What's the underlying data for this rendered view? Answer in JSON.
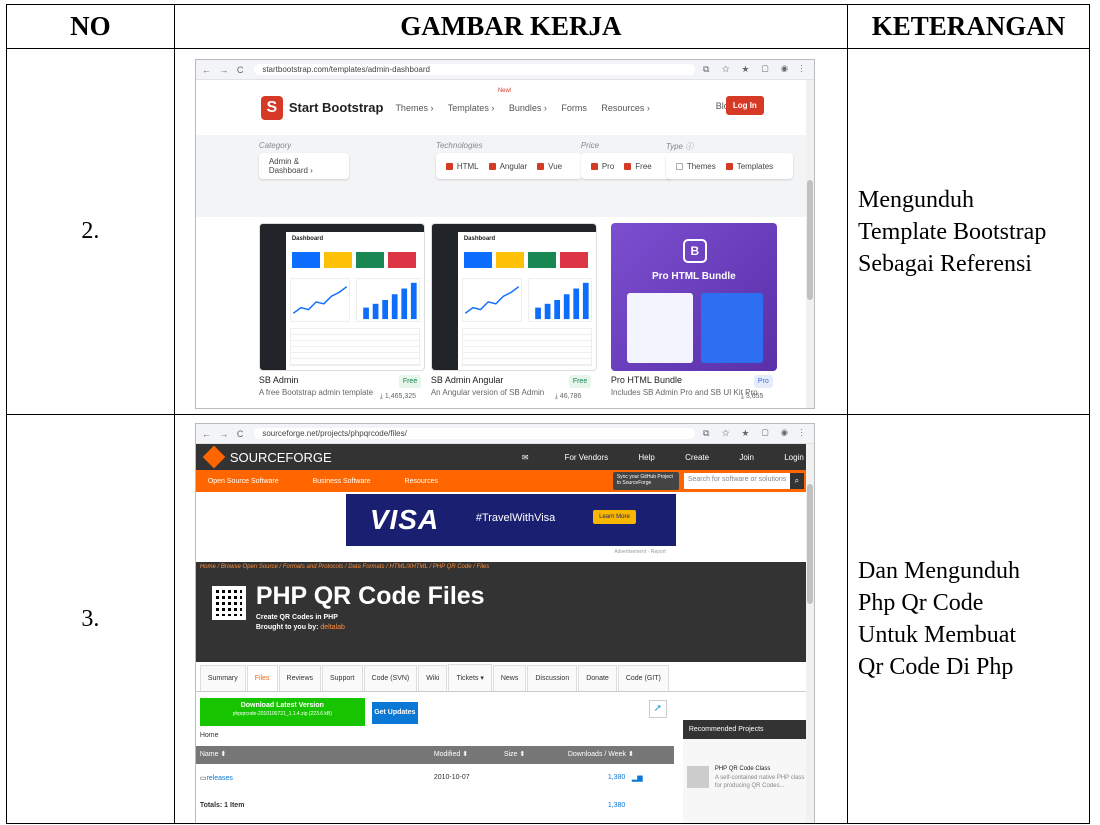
{
  "table": {
    "headers": {
      "no": "NO",
      "gambar": "GAMBAR KERJA",
      "keterangan": "KETERANGAN"
    },
    "rows": [
      {
        "no": "2.",
        "keterangan_lines": [
          "Mengunduh",
          "Template Bootstrap",
          "Sebagai Referensi"
        ]
      },
      {
        "no": "3.",
        "keterangan_lines": [
          "Dan Mengunduh",
          "Php Qr Code",
          "Untuk Membuat",
          "Qr Code Di Php"
        ]
      }
    ]
  },
  "shot1": {
    "url": "startbootstrap.com/templates/admin-dashboard",
    "brand": "Start Bootstrap",
    "logo_letter": "S",
    "nav": [
      "Themes ›",
      "Templates ›",
      "Bundles ›",
      "Forms",
      "Resources ›"
    ],
    "new_badge": "New!",
    "blog": "Blog",
    "login": "Log In",
    "filters": {
      "category_caption": "Category",
      "category_value": "Admin & Dashboard ›",
      "technologies_caption": "Technologies",
      "technologies": [
        "HTML",
        "Angular",
        "Vue"
      ],
      "price_caption": "Price",
      "price": [
        "Pro",
        "Free"
      ],
      "type_caption": "Type ⓘ",
      "type": [
        "Themes",
        "Templates"
      ]
    },
    "card_dash_title": "Dashboard",
    "pro_logo": "B",
    "pro_title": "Pro HTML Bundle",
    "cards": [
      {
        "title": "SB Admin",
        "desc": "A free Bootstrap admin template",
        "badge": "Free",
        "downloads": "⤓ 1,465,325"
      },
      {
        "title": "SB Admin Angular",
        "desc": "An Angular version of SB Admin",
        "badge": "Free",
        "downloads": "⤓ 46,786"
      },
      {
        "title": "Pro HTML Bundle",
        "desc": "Includes SB Admin Pro and SB UI Kit Pro",
        "badge": "Pro",
        "downloads": "⤓ 3,655"
      }
    ],
    "colors": {
      "accent": "#d63a26",
      "free": "#e6f6ea",
      "pro": "#e6ecfb"
    }
  },
  "shot2": {
    "url": "sourceforge.net/projects/phpqrcode/files/",
    "logo_text": "SOURCEFORGE",
    "top_links": [
      "For Vendors",
      "Help",
      "Create",
      "Join",
      "Login"
    ],
    "orange_links": [
      "Open Source Software",
      "Business Software",
      "Resources"
    ],
    "github_sync": "Sync your GitHub Project to SourceForge",
    "search_placeholder": "Search for software or solutions",
    "ad_brand": "VISA",
    "ad_tag": "#TravelWithVisa",
    "ad_btn": "Learn More",
    "ad_note": "Advertisement · Report",
    "breadcrumb": "Home / Browse Open Source / Formats and Protocols / Data Formats / HTML/XHTML / PHP QR Code / Files",
    "title": "PHP QR Code Files",
    "subtitle": "Create QR Codes in PHP",
    "brought_by": "Brought to you by:",
    "author": "deltalab",
    "tabs": [
      "Summary",
      "Files",
      "Reviews",
      "Support",
      "Code (SVN)",
      "Wiki",
      "Tickets ▾",
      "News",
      "Discussion",
      "Donate",
      "Code (GIT)"
    ],
    "download_label": "Download Latest Version",
    "download_file": "phpqrcode-2010100721_1.1.4.zip (223.6 kB)",
    "get_updates": "Get Updates",
    "home_label": "Home",
    "col_name": "Name ⬍",
    "col_modified": "Modified ⬍",
    "col_size": "Size ⬍",
    "col_downloads": "Downloads / Week ⬍",
    "row_name": "releases",
    "row_modified": "2010-10-07",
    "row_downloads": "1,380",
    "totals_label": "Totals: 1 Item",
    "totals_downloads": "1,380",
    "recommended": "Recommended Projects",
    "rec_title": "PHP QR Code Class",
    "rec_desc": "A self-contained native PHP class for producing QR Codes...",
    "colors": {
      "brand": "#ff6600",
      "dark": "#333333",
      "green": "#16c500"
    }
  }
}
